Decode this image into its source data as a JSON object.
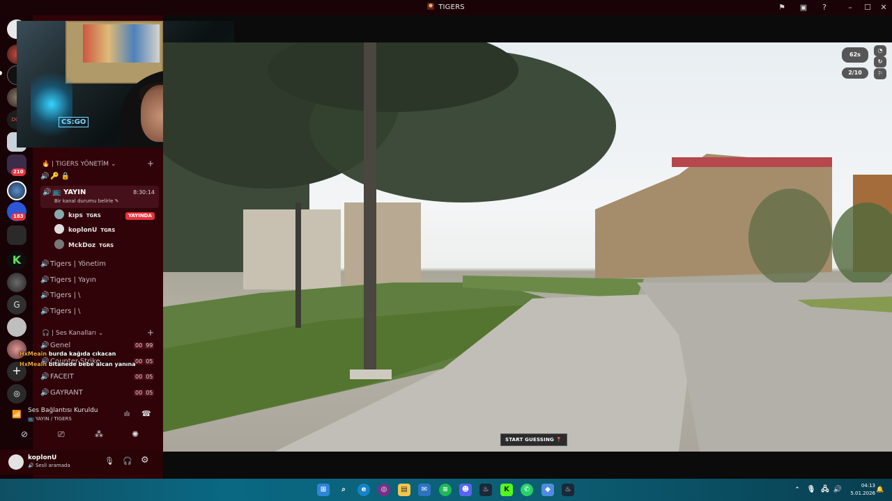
{
  "window": {
    "title": "TIGERS"
  },
  "titlebar": {
    "flag_icon": "flag-icon",
    "tv_icon": "tv-icon",
    "help_icon": "help-icon"
  },
  "rail": {
    "badges": [
      "210",
      "183"
    ],
    "letter_server": "G"
  },
  "channels": {
    "category_manage": "| TIGERS YÖNETİM",
    "category_voice": "| Ses Kanalları",
    "live_channel": {
      "name": "YAYIN",
      "timer": "8:30:14",
      "status": "Bir kanal durumu belirle"
    },
    "members": [
      {
        "name": "kıps",
        "tag": "TGRS",
        "live": "YAYINDA"
      },
      {
        "name": "koplonU",
        "tag": "TGRS",
        "live": ""
      },
      {
        "name": "MckDoz",
        "tag": "TGRS",
        "live": ""
      }
    ],
    "stage_channels": [
      "Tigers | Yönetim",
      "Tigers | Yayın",
      "Tigers | \\",
      "Tigers | \\"
    ],
    "voice_channels": [
      {
        "name": "Genel",
        "a": "00",
        "b": "99"
      },
      {
        "name": "Counter-Strike",
        "a": "00",
        "b": "05"
      },
      {
        "name": "FACEIT",
        "a": "00",
        "b": "05"
      },
      {
        "name": "GAYRANT",
        "a": "00",
        "b": "05"
      }
    ]
  },
  "chat_overlay": [
    {
      "user": "HxMeain",
      "text": "burda kağıda cıkacan"
    },
    {
      "user": "HxMeain",
      "text": "bitanede bebe alcan yanına"
    }
  ],
  "voice": {
    "status": "Ses Bağlantısı Kuruldu",
    "channel": "YAYIN / TIGERS"
  },
  "userbar": {
    "name": "koplonU",
    "status": "Sesli aramada"
  },
  "game": {
    "timer": "62s",
    "round": "2/10",
    "start_button": "START GUESSING"
  },
  "clock": {
    "time": "04:13",
    "date": "5.01.2026"
  }
}
